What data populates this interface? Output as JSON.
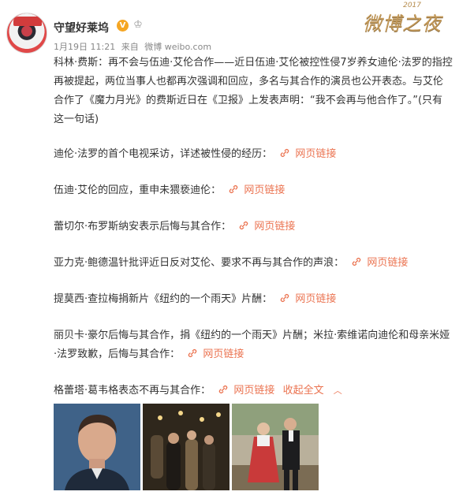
{
  "user": {
    "name": "守望好莱坞",
    "verified_mark": "V",
    "date": "1月19日 11:21",
    "source_prefix": "来自",
    "source": "微博 weibo.com"
  },
  "event_logo": {
    "year": "2017",
    "text": "微博之夜"
  },
  "post": {
    "intro": "科林·费斯：再不会与伍迪·艾伦合作——近日伍迪·艾伦被控性侵7岁养女迪伦·法罗的指控再被提起，两位当事人也都再次强调和回应，多名与其合作的演员也公开表态。与艾伦合作了《魔力月光》的费斯近日在《卫报》上发表声明：“我不会再与他合作了。”(只有这一句话)",
    "link_label": "网页链接",
    "items": [
      {
        "text": "迪伦·法罗的首个电视采访，详述被性侵的经历："
      },
      {
        "text": "伍迪·艾伦的回应，重申未猥亵迪伦："
      },
      {
        "text": "蕾切尔·布罗斯纳安表示后悔与其合作："
      },
      {
        "text": "亚力克·鲍德温针批评近日反对艾伦、要求不再与其合作的声浪："
      },
      {
        "text": "提莫西·查拉梅捐新片《纽约的一个雨天》片酬："
      },
      {
        "text": "丽贝卡·豪尔后悔与其合作，捐《纽约的一个雨天》片酬；米拉·索维诺向迪伦和母亲米娅·法罗致歉，后悔与其合作："
      },
      {
        "text": "格蕾塔·葛韦格表态不再与其合作："
      }
    ],
    "collapse_label": "收起全文"
  },
  "icons": {
    "link": "link-icon",
    "chevron": "chevron-up-icon",
    "crown": "crown-icon"
  },
  "colors": {
    "link": "#eb7350",
    "verified": "#f5a623",
    "text": "#333333",
    "meta": "#888888"
  }
}
